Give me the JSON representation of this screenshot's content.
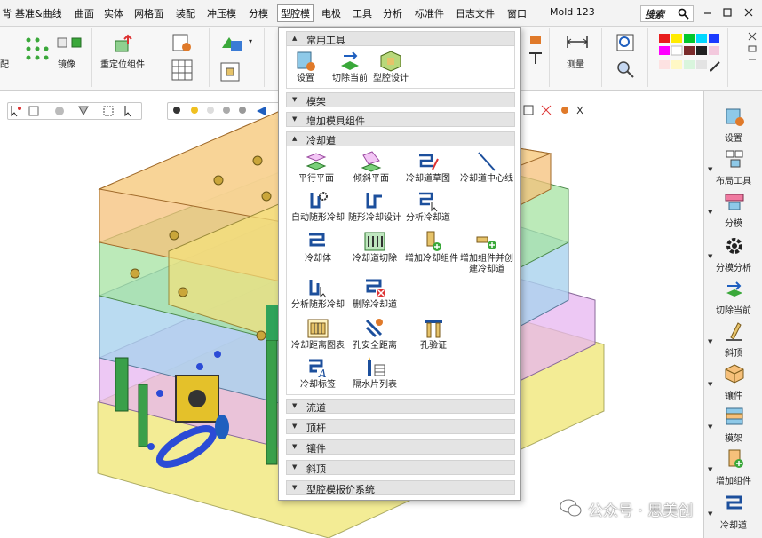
{
  "menubar": {
    "items": [
      "背",
      "基准&曲线",
      "曲面",
      "实体",
      "网格面",
      "装配",
      "冲压模",
      "分模",
      "型腔模",
      "电极",
      "工具",
      "分析",
      "标准件",
      "日志文件",
      "窗口",
      "Mold 123"
    ],
    "active_index": 8,
    "search_label": "搜索"
  },
  "ribbon": {
    "mirror_label": "镜像",
    "reposition_label": "重定位组件",
    "measure_label": "测量",
    "left_cut_label": "配"
  },
  "dropdown": {
    "sections": [
      {
        "title": "常用工具",
        "expanded": true,
        "tools": [
          "设置",
          "切除当前",
          "型腔设计"
        ]
      },
      {
        "title": "模架",
        "expanded": false
      },
      {
        "title": "增加模具组件",
        "expanded": false
      },
      {
        "title": "冷却道",
        "expanded": true,
        "tools": [
          "平行平面",
          "倾斜平面",
          "冷却道草图",
          "冷却道中心线",
          "自动随形冷却",
          "随形冷却设计",
          "分析冷却道",
          "冷却体",
          "冷却道切除",
          "增加冷却组件",
          "增加组件并创建冷却道",
          "分析随形冷却",
          "删除冷却道",
          "冷却距离图表",
          "孔安全距离",
          "孔验证",
          "冷却标签",
          "隔水片列表"
        ]
      },
      {
        "title": "流道",
        "expanded": false
      },
      {
        "title": "顶杆",
        "expanded": false
      },
      {
        "title": "镶件",
        "expanded": false
      },
      {
        "title": "斜顶",
        "expanded": false
      },
      {
        "title": "型腔模报价系统",
        "expanded": false
      }
    ]
  },
  "right_panel": {
    "items": [
      "设置",
      "布局工具",
      "分模",
      "分模分析",
      "切除当前",
      "斜顶",
      "镶件",
      "模架",
      "增加组件",
      "冷却道"
    ]
  },
  "watermark": "公众号 · 思美创",
  "colors": {
    "accent": "#1f5fbf",
    "cooling": "#1c4f9c",
    "green": "#3aa83a",
    "panel": "#f2f2f2"
  }
}
